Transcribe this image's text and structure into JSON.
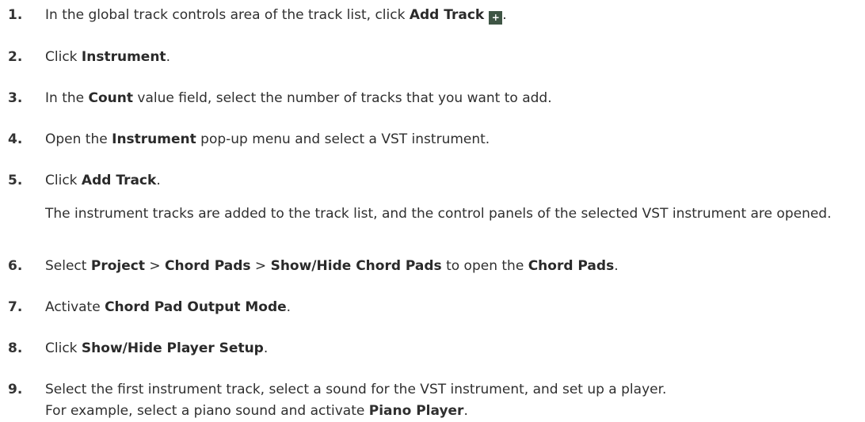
{
  "steps": [
    {
      "num": "1.",
      "parts": [
        {
          "t": "In the global track controls area of the track list, click "
        },
        {
          "t": "Add Track",
          "b": true
        },
        {
          "icon": "add-track-icon"
        },
        {
          "t": "."
        }
      ]
    },
    {
      "num": "2.",
      "parts": [
        {
          "t": "Click "
        },
        {
          "t": "Instrument",
          "b": true
        },
        {
          "t": "."
        }
      ]
    },
    {
      "num": "3.",
      "parts": [
        {
          "t": "In the "
        },
        {
          "t": "Count",
          "b": true
        },
        {
          "t": " value field, select the number of tracks that you want to add."
        }
      ]
    },
    {
      "num": "4.",
      "parts": [
        {
          "t": "Open the "
        },
        {
          "t": "Instrument",
          "b": true
        },
        {
          "t": " pop-up menu and select a VST instrument."
        }
      ]
    },
    {
      "num": "5.",
      "parts": [
        {
          "t": "Click "
        },
        {
          "t": "Add Track",
          "b": true
        },
        {
          "t": "."
        }
      ],
      "note": "The instrument tracks are added to the track list, and the control panels of the selected VST instrument are opened."
    },
    {
      "num": "6.",
      "parts": [
        {
          "t": "Select "
        },
        {
          "t": "Project",
          "b": true
        },
        {
          "t": " > "
        },
        {
          "t": "Chord Pads",
          "b": true
        },
        {
          "t": " > "
        },
        {
          "t": "Show/Hide Chord Pads",
          "b": true
        },
        {
          "t": " to open the "
        },
        {
          "t": "Chord Pads",
          "b": true
        },
        {
          "t": "."
        }
      ]
    },
    {
      "num": "7.",
      "parts": [
        {
          "t": "Activate "
        },
        {
          "t": "Chord Pad Output Mode",
          "b": true
        },
        {
          "t": "."
        }
      ]
    },
    {
      "num": "8.",
      "parts": [
        {
          "t": "Click "
        },
        {
          "t": "Show/Hide Player Setup",
          "b": true
        },
        {
          "t": "."
        }
      ]
    },
    {
      "num": "9.",
      "parts": [
        {
          "t": "Select the first instrument track, select a sound for the VST instrument, and set up a player."
        }
      ],
      "note_parts": [
        {
          "t": "For example, select a piano sound and activate "
        },
        {
          "t": "Piano Player",
          "b": true
        },
        {
          "t": "."
        }
      ]
    }
  ],
  "icons": {
    "add-track-icon": "+"
  },
  "colors": {
    "text": "#2f2f2f",
    "icon_bg": "#3f5545",
    "icon_fg": "#ffffff"
  }
}
